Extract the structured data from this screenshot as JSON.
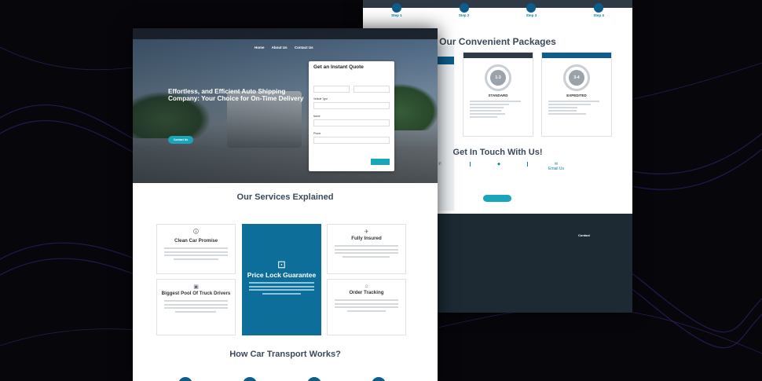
{
  "colors": {
    "background": "#07060b",
    "accent": "#19a6b8",
    "primary": "#0d6e9a",
    "heading": "#3a4a5a",
    "footer": "#1d2a33"
  },
  "back": {
    "steps": [
      {
        "label": "Step 1",
        "text": ""
      },
      {
        "label": "Step 2",
        "text": ""
      },
      {
        "label": "Step 3",
        "text": ""
      },
      {
        "label": "Step 4",
        "text": ""
      }
    ],
    "packages_title": "Our Convenient Packages",
    "packages_sub": "",
    "packages": [
      {
        "tag": "",
        "ring": "1-3",
        "name": "STANDARD"
      },
      {
        "tag": "",
        "ring": "3-4",
        "name": "EXPEDITED"
      }
    ],
    "touch_title": "Get In Touch With Us!",
    "contacts": [
      {
        "icon": "✆",
        "title": "",
        "text": ""
      },
      {
        "icon": "◆",
        "title": "",
        "text": ""
      },
      {
        "icon": "✉",
        "title": "Email Us",
        "text": ""
      }
    ],
    "touch_button": "",
    "footer": {
      "cols": [
        {
          "head": "",
          "items": [
            "",
            "",
            "",
            ""
          ]
        },
        {
          "head": "",
          "items": [
            "",
            "",
            "",
            ""
          ]
        },
        {
          "head": "Contact",
          "items": [
            "",
            ""
          ]
        }
      ],
      "copyright": ""
    }
  },
  "front": {
    "infobar": {
      "hours": "",
      "logo": "",
      "phone": ""
    },
    "nav": [
      "Home",
      "About Us",
      "Contact Us"
    ],
    "headline": "Effortless, and Efficient Auto Shipping Company: Your Choice for On-Time Delivery",
    "hero_text": "",
    "hero_link": "",
    "hero_button": "Contact Us",
    "quote": {
      "title": "Get an Instant Quote",
      "call": "",
      "fields": [
        {
          "label": "",
          "placeholder": ""
        },
        {
          "label": "",
          "placeholder": ""
        },
        {
          "label": "Vehicle Type",
          "placeholder": ""
        },
        {
          "label": "Name",
          "placeholder": ""
        },
        {
          "label": "Phone",
          "placeholder": ""
        }
      ],
      "note": "",
      "button": ""
    },
    "services_title": "Our Services Explained",
    "services_sub": "",
    "services": [
      {
        "name": "Clean Car Promise",
        "icon": "🛈"
      },
      {
        "name": "Price Lock Guarantee",
        "icon": "⊡"
      },
      {
        "name": "Fully Insured",
        "icon": "✈"
      },
      {
        "name": "Biggest Pool Of Truck Drivers",
        "icon": "▣"
      },
      {
        "name": "Order Tracking",
        "icon": "⌂"
      }
    ],
    "how_title": "How Car Transport Works?",
    "how_sub": ""
  }
}
